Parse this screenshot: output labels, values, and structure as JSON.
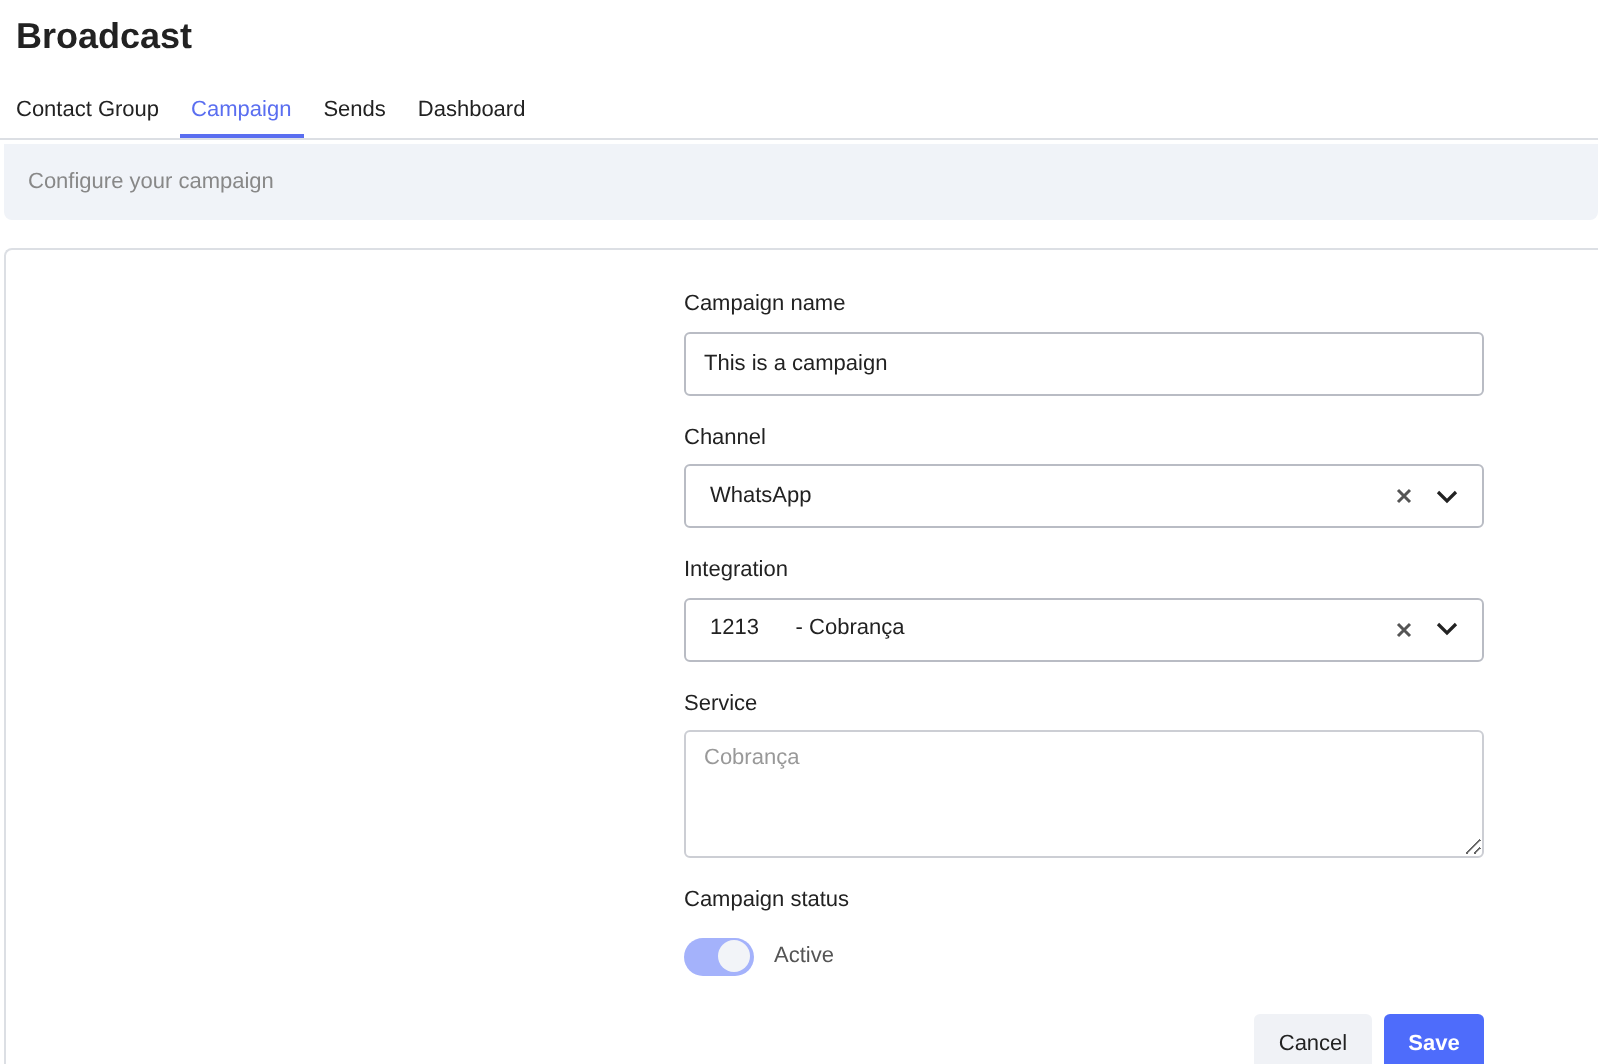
{
  "page": {
    "title": "Broadcast"
  },
  "tabs": [
    {
      "label": "Contact Group",
      "selected": false
    },
    {
      "label": "Campaign",
      "selected": true
    },
    {
      "label": "Sends",
      "selected": false
    },
    {
      "label": "Dashboard",
      "selected": false
    }
  ],
  "section_header": {
    "subtitle": "Configure your campaign"
  },
  "form": {
    "campaign_name": {
      "label": "Campaign name",
      "value": "This is a campaign"
    },
    "channel": {
      "label": "Channel",
      "value": "WhatsApp"
    },
    "integration": {
      "label": "Integration",
      "value": "1213      - Cobrança"
    },
    "service": {
      "label": "Service",
      "placeholder": "Cobrança"
    },
    "status": {
      "label": "Campaign status",
      "on": true,
      "text": "Active"
    }
  },
  "buttons": {
    "cancel": "Cancel",
    "save": "Save"
  }
}
